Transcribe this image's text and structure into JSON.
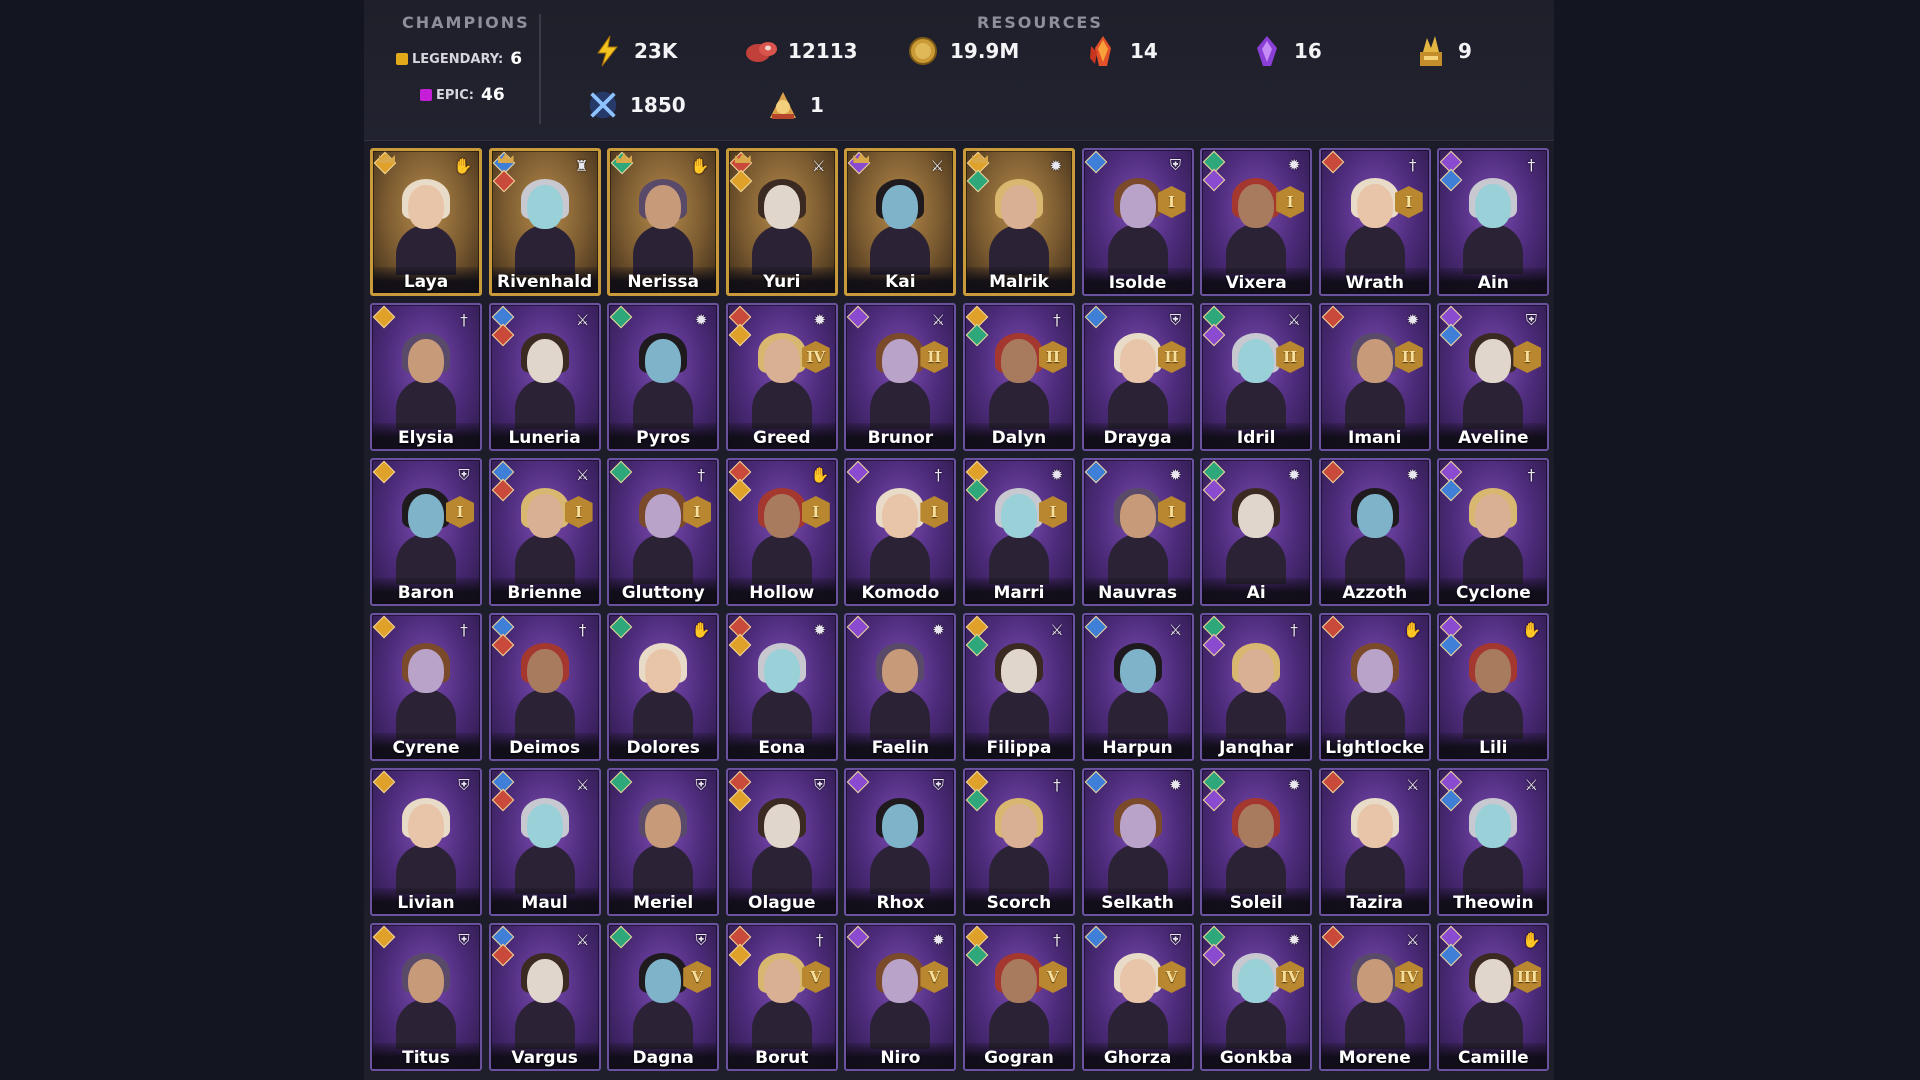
{
  "header": {
    "champions_title": "CHAMPIONS",
    "resources_title": "RESOURCES",
    "legendary_label": "LEGENDARY:",
    "legendary_count": "6",
    "epic_label": "EPIC:",
    "epic_count": "46",
    "resources": [
      {
        "icon": "energy-bolt-icon",
        "value": "23K"
      },
      {
        "icon": "raw-meat-icon",
        "value": "12113"
      },
      {
        "icon": "gold-coin-icon",
        "value": "19.9M"
      },
      {
        "icon": "fire-crystal-icon",
        "value": "14"
      },
      {
        "icon": "purple-crystal-icon",
        "value": "16"
      },
      {
        "icon": "gold-relic-icon",
        "value": "9"
      },
      {
        "icon": "crossed-swords-icon",
        "value": "1850"
      },
      {
        "icon": "medal-token-icon",
        "value": "1"
      }
    ]
  },
  "colors": {
    "legendary": "#c89a3a",
    "epic": "#6a52a0",
    "legendary_dot": "#e2a91a",
    "epic_dot": "#c41fd6"
  },
  "champions": [
    {
      "name": "Laya",
      "rarity": "legendary",
      "role": "support-hands-icon",
      "rank": ""
    },
    {
      "name": "Rivenhald",
      "rarity": "legendary",
      "role": "rook-icon",
      "rank": ""
    },
    {
      "name": "Nerissa",
      "rarity": "legendary",
      "role": "support-hands-icon",
      "rank": ""
    },
    {
      "name": "Yuri",
      "rarity": "legendary",
      "role": "crossed-swords-icon",
      "rank": ""
    },
    {
      "name": "Kai",
      "rarity": "legendary",
      "role": "crossed-swords-icon",
      "rank": ""
    },
    {
      "name": "Malrik",
      "rarity": "legendary",
      "role": "magic-burst-icon",
      "rank": ""
    },
    {
      "name": "Isolde",
      "rarity": "epic",
      "role": "shield-icon",
      "rank": "I"
    },
    {
      "name": "Vixera",
      "rarity": "epic",
      "role": "magic-burst-icon",
      "rank": "I"
    },
    {
      "name": "Wrath",
      "rarity": "epic",
      "role": "sword-icon",
      "rank": "I"
    },
    {
      "name": "Ain",
      "rarity": "epic",
      "role": "sword-icon",
      "rank": ""
    },
    {
      "name": "Elysia",
      "rarity": "epic",
      "role": "sword-icon",
      "rank": ""
    },
    {
      "name": "Luneria",
      "rarity": "epic",
      "role": "crossed-swords-icon",
      "rank": ""
    },
    {
      "name": "Pyros",
      "rarity": "epic",
      "role": "magic-burst-icon",
      "rank": ""
    },
    {
      "name": "Greed",
      "rarity": "epic",
      "role": "magic-burst-icon",
      "rank": "IV"
    },
    {
      "name": "Brunor",
      "rarity": "epic",
      "role": "crossed-swords-icon",
      "rank": "II"
    },
    {
      "name": "Dalyn",
      "rarity": "epic",
      "role": "sword-icon",
      "rank": "II"
    },
    {
      "name": "Drayga",
      "rarity": "epic",
      "role": "shield-icon",
      "rank": "II"
    },
    {
      "name": "Idril",
      "rarity": "epic",
      "role": "crossed-swords-icon",
      "rank": "II"
    },
    {
      "name": "Imani",
      "rarity": "epic",
      "role": "magic-burst-icon",
      "rank": "II"
    },
    {
      "name": "Aveline",
      "rarity": "epic",
      "role": "shield-icon",
      "rank": "I"
    },
    {
      "name": "Baron",
      "rarity": "epic",
      "role": "shield-icon",
      "rank": "I"
    },
    {
      "name": "Brienne",
      "rarity": "epic",
      "role": "crossed-swords-icon",
      "rank": "I"
    },
    {
      "name": "Gluttony",
      "rarity": "epic",
      "role": "sword-icon",
      "rank": "I"
    },
    {
      "name": "Hollow",
      "rarity": "epic",
      "role": "support-hands-icon",
      "rank": "I"
    },
    {
      "name": "Komodo",
      "rarity": "epic",
      "role": "sword-icon",
      "rank": "I"
    },
    {
      "name": "Marri",
      "rarity": "epic",
      "role": "magic-burst-icon",
      "rank": "I"
    },
    {
      "name": "Nauvras",
      "rarity": "epic",
      "role": "magic-burst-icon",
      "rank": "I"
    },
    {
      "name": "Ai",
      "rarity": "epic",
      "role": "magic-burst-icon",
      "rank": ""
    },
    {
      "name": "Azzoth",
      "rarity": "epic",
      "role": "magic-burst-icon",
      "rank": ""
    },
    {
      "name": "Cyclone",
      "rarity": "epic",
      "role": "sword-icon",
      "rank": ""
    },
    {
      "name": "Cyrene",
      "rarity": "epic",
      "role": "sword-icon",
      "rank": ""
    },
    {
      "name": "Deimos",
      "rarity": "epic",
      "role": "sword-icon",
      "rank": ""
    },
    {
      "name": "Dolores",
      "rarity": "epic",
      "role": "support-hands-icon",
      "rank": ""
    },
    {
      "name": "Eona",
      "rarity": "epic",
      "role": "magic-burst-icon",
      "rank": ""
    },
    {
      "name": "Faelin",
      "rarity": "epic",
      "role": "magic-burst-icon",
      "rank": ""
    },
    {
      "name": "Filippa",
      "rarity": "epic",
      "role": "crossed-swords-icon",
      "rank": ""
    },
    {
      "name": "Harpun",
      "rarity": "epic",
      "role": "crossed-swords-icon",
      "rank": ""
    },
    {
      "name": "Janqhar",
      "rarity": "epic",
      "role": "sword-icon",
      "rank": ""
    },
    {
      "name": "Lightlocke",
      "rarity": "epic",
      "role": "support-hands-icon",
      "rank": ""
    },
    {
      "name": "Lili",
      "rarity": "epic",
      "role": "support-hands-icon",
      "rank": ""
    },
    {
      "name": "Livian",
      "rarity": "epic",
      "role": "shield-icon",
      "rank": ""
    },
    {
      "name": "Maul",
      "rarity": "epic",
      "role": "crossed-swords-icon",
      "rank": ""
    },
    {
      "name": "Meriel",
      "rarity": "epic",
      "role": "shield-icon",
      "rank": ""
    },
    {
      "name": "Olague",
      "rarity": "epic",
      "role": "shield-icon",
      "rank": ""
    },
    {
      "name": "Rhox",
      "rarity": "epic",
      "role": "shield-icon",
      "rank": ""
    },
    {
      "name": "Scorch",
      "rarity": "epic",
      "role": "sword-icon",
      "rank": ""
    },
    {
      "name": "Selkath",
      "rarity": "epic",
      "role": "magic-burst-icon",
      "rank": ""
    },
    {
      "name": "Soleil",
      "rarity": "epic",
      "role": "magic-burst-icon",
      "rank": ""
    },
    {
      "name": "Tazira",
      "rarity": "epic",
      "role": "crossed-swords-icon",
      "rank": ""
    },
    {
      "name": "Theowin",
      "rarity": "epic",
      "role": "crossed-swords-icon",
      "rank": ""
    },
    {
      "name": "Titus",
      "rarity": "epic",
      "role": "shield-icon",
      "rank": ""
    },
    {
      "name": "Vargus",
      "rarity": "epic",
      "role": "crossed-swords-icon",
      "rank": ""
    },
    {
      "name": "Dagna",
      "rarity": "epic",
      "role": "shield-icon",
      "rank": "V"
    },
    {
      "name": "Borut",
      "rarity": "epic",
      "role": "sword-icon",
      "rank": "V"
    },
    {
      "name": "Niro",
      "rarity": "epic",
      "role": "magic-burst-icon",
      "rank": "V"
    },
    {
      "name": "Gogran",
      "rarity": "epic",
      "role": "sword-icon",
      "rank": "V"
    },
    {
      "name": "Ghorza",
      "rarity": "epic",
      "role": "shield-icon",
      "rank": "V"
    },
    {
      "name": "Gonkba",
      "rarity": "epic",
      "role": "magic-burst-icon",
      "rank": "IV"
    },
    {
      "name": "Morene",
      "rarity": "epic",
      "role": "crossed-swords-icon",
      "rank": "IV"
    },
    {
      "name": "Camille",
      "rarity": "epic",
      "role": "support-hands-icon",
      "rank": "III"
    }
  ]
}
